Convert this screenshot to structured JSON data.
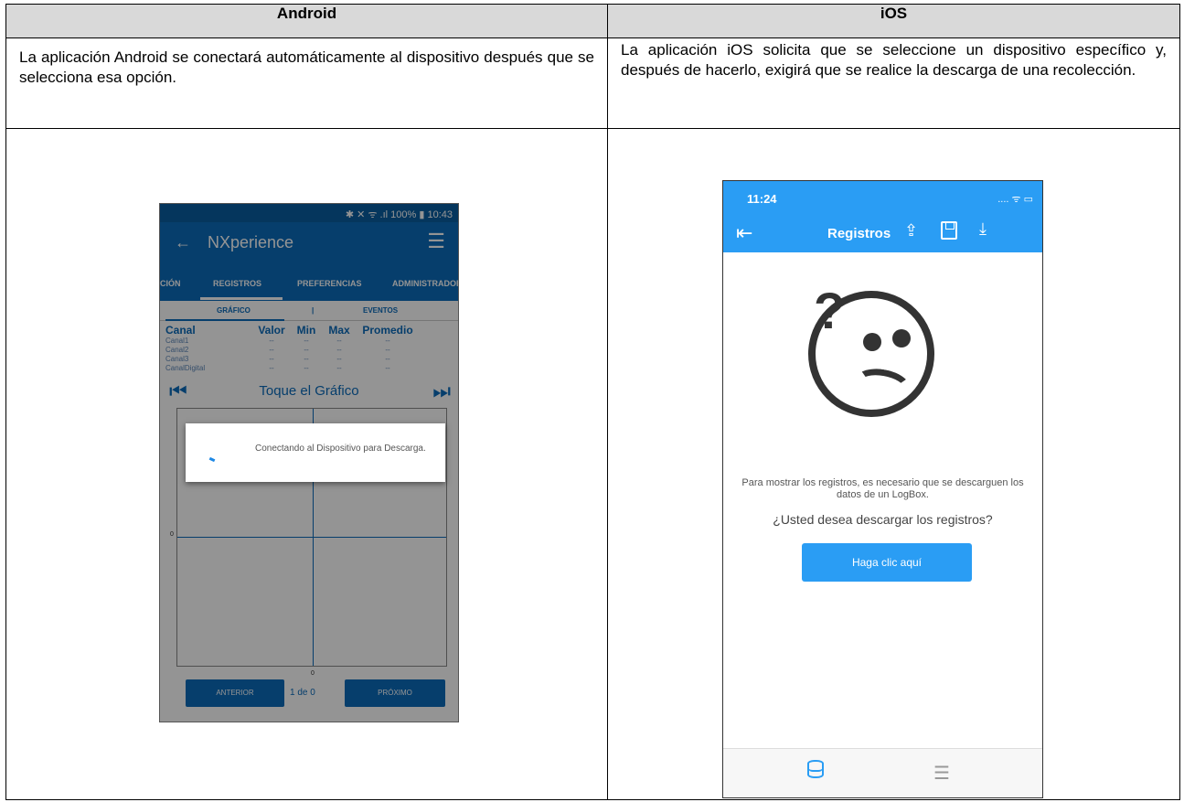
{
  "table": {
    "headers": [
      "Android",
      "iOS"
    ],
    "android_desc": "La aplicación Android se conectará automáticamente al dispositivo después que se selecciona esa opción.",
    "ios_desc": "La aplicación iOS solicita que se seleccione un dispositivo específico y, después de hacerlo, exigirá que se realice la descarga de una recolección."
  },
  "android_app": {
    "status_bar": "✱ ✕ ᯤ .ıl 100% ▮ 10:43",
    "title": "NXperience",
    "tabs": [
      "CIÓN",
      "REGISTROS",
      "PREFERENCIAS",
      "ADMINISTRADOR"
    ],
    "subtabs": [
      "GRÁFICO",
      "EVENTOS"
    ],
    "columns": [
      "Canal",
      "Valor",
      "Min",
      "Max",
      "Promedio"
    ],
    "rows": [
      [
        "Canal1",
        "--",
        "--",
        "--",
        "--"
      ],
      [
        "Canal2",
        "--",
        "--",
        "--",
        "--"
      ],
      [
        "Canal3",
        "--",
        "--",
        "--",
        "--"
      ],
      [
        "CanalDigital",
        "--",
        "--",
        "--",
        "--"
      ]
    ],
    "touch_graph": "Toque el Gráfico",
    "axis_zero": "0",
    "prev_button": "ANTERIOR",
    "page_indicator": "1 de 0",
    "next_button": "PRÓXIMO",
    "dialog_text": "Conectando al Dispositivo para Descarga."
  },
  "ios_app": {
    "time": "11:24",
    "status_icons": ".... ᯤ ▭",
    "title": "Registros",
    "message": "Para mostrar los registros, es necesario que se descarguen los datos de un LogBox.",
    "question": "¿Usted desea descargar los registros?",
    "button": "Haga clic aquí"
  },
  "colors": {
    "android_primary": "#0b6bbb",
    "ios_primary": "#2a9df4",
    "header_gray": "#d9d9d9"
  }
}
